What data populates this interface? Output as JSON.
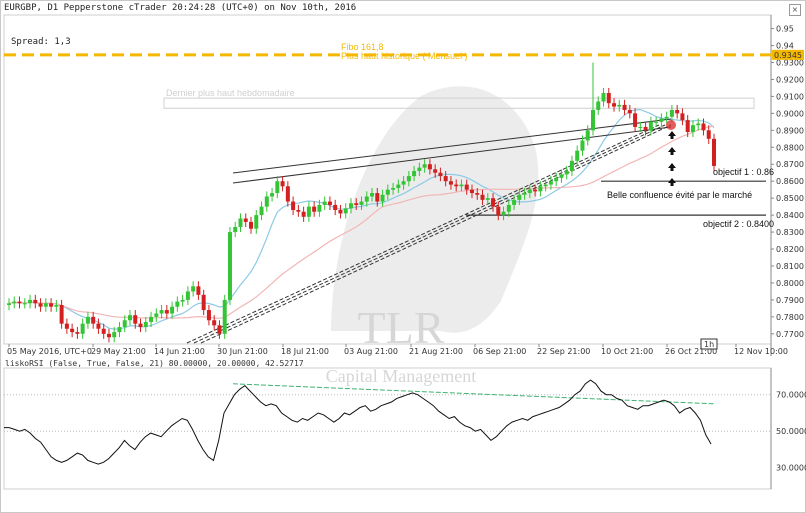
{
  "header": {
    "title": "EURGBP, D1 Pepperstone cTrader 20:24:28 (UTC+0) on Nov 10th, 2016"
  },
  "spread": {
    "label": "Spread:",
    "value": "1,3"
  },
  "colors": {
    "bull": "#35c435",
    "bear": "#d21f1f",
    "fibo": "#f5b800",
    "ma_fast": "#8ecae6",
    "ma_slow": "#f2b6b6",
    "rsi": "#111111",
    "rsi_trend": "#3cb371",
    "price_tag": "#f5b800"
  },
  "annotations": {
    "fibo_line1": "Fibo 161,8",
    "fibo_line2": "Plus haut historique ( Mensuel )",
    "rect_label": "Dernier plus haut hebdomadaire",
    "obj1": "objectif 1 : 0.86",
    "confluence": "Belle confluence évité par le marché",
    "obj2": "objectif 2 : 0.8400",
    "price_tag": "0.9345"
  },
  "timeframe_badge": "1h",
  "indicator": {
    "title": "liskoRSI (False, True, False, 21) 80.00000, 20.00000, 42.52717"
  },
  "watermark": {
    "brand": "TLR",
    "sub": "Capital Management"
  },
  "chart_data": [
    {
      "type": "candlestick",
      "title": "EURGBP, D1",
      "x_tick_labels": [
        "05 May 2016, UTC+0",
        "29 May 21:00",
        "14 Jun 21:00",
        "30 Jun 21:00",
        "18 Jul 21:00",
        "03 Aug 21:00",
        "21 Aug 21:00",
        "06 Sep 21:00",
        "22 Sep 21:00",
        "10 Oct 21:00",
        "26 Oct 21:00",
        "12 Nov 10:00"
      ],
      "y_ticks": [
        0.95,
        0.94,
        0.93,
        0.92,
        0.91,
        0.9,
        0.89,
        0.88,
        0.87,
        0.86,
        0.85,
        0.84,
        0.83,
        0.82,
        0.81,
        0.8,
        0.79,
        0.78,
        0.77
      ],
      "y_tick_labels": [
        "0.95",
        "0.94",
        "0.9300",
        "0.9200",
        "0.9100",
        "0.9000",
        "0.8900",
        "0.8800",
        "0.8700",
        "0.8600",
        "0.8500",
        "0.8400",
        "0.8300",
        "0.8200",
        "0.8100",
        "0.8000",
        "0.7900",
        "0.7800",
        "0.7700"
      ],
      "ylim": [
        0.764,
        0.958
      ],
      "closes": [
        0.788,
        0.789,
        0.788,
        0.788,
        0.79,
        0.788,
        0.786,
        0.788,
        0.786,
        0.787,
        0.776,
        0.773,
        0.771,
        0.77,
        0.776,
        0.78,
        0.776,
        0.773,
        0.77,
        0.768,
        0.771,
        0.774,
        0.778,
        0.781,
        0.776,
        0.774,
        0.777,
        0.78,
        0.782,
        0.784,
        0.782,
        0.786,
        0.789,
        0.79,
        0.795,
        0.798,
        0.793,
        0.784,
        0.778,
        0.775,
        0.77,
        0.79,
        0.83,
        0.833,
        0.838,
        0.836,
        0.832,
        0.84,
        0.845,
        0.851,
        0.853,
        0.86,
        0.857,
        0.848,
        0.843,
        0.842,
        0.839,
        0.845,
        0.842,
        0.846,
        0.848,
        0.846,
        0.843,
        0.841,
        0.844,
        0.847,
        0.846,
        0.848,
        0.851,
        0.853,
        0.848,
        0.852,
        0.855,
        0.856,
        0.858,
        0.86,
        0.863,
        0.866,
        0.868,
        0.87,
        0.867,
        0.865,
        0.863,
        0.86,
        0.858,
        0.857,
        0.858,
        0.855,
        0.853,
        0.852,
        0.849,
        0.85,
        0.845,
        0.84,
        0.842,
        0.846,
        0.849,
        0.852,
        0.853,
        0.855,
        0.854,
        0.857,
        0.858,
        0.86,
        0.862,
        0.864,
        0.866,
        0.872,
        0.878,
        0.884,
        0.89,
        0.902,
        0.907,
        0.912,
        0.906,
        0.904,
        0.905,
        0.902,
        0.9,
        0.892,
        0.892,
        0.89,
        0.895,
        0.895,
        0.897,
        0.898,
        0.902,
        0.9,
        0.896,
        0.889,
        0.893,
        0.894,
        0.89,
        0.885,
        0.869
      ],
      "events": [
        {
          "index": 111,
          "high": 0.93
        },
        {
          "index": 41,
          "high": 0.77
        }
      ],
      "series": [
        {
          "name": "MA fast",
          "values": []
        },
        {
          "name": "MA slow",
          "values": []
        }
      ],
      "levels": [
        {
          "name": "Fibo 161,8",
          "value": 0.9345
        },
        {
          "name": "objectif 1",
          "value": 0.86
        },
        {
          "name": "objectif 2",
          "value": 0.84
        },
        {
          "name": "Dernier plus haut hebdomadaire",
          "value_low": 0.903,
          "value_high": 0.909
        }
      ],
      "grid": true
    },
    {
      "type": "line",
      "title": "liskoRSI (False, True, False, 21)",
      "y_ticks": [
        70,
        50,
        30
      ],
      "y_tick_labels": [
        "70.00000",
        "50.00000",
        "30.00000"
      ],
      "ylim": [
        20,
        83
      ],
      "values": [
        52,
        52,
        51,
        50,
        51,
        49,
        46,
        44,
        40,
        36,
        34,
        33,
        34,
        36,
        38,
        37,
        34,
        33,
        32,
        33,
        35,
        38,
        41,
        45,
        42,
        40,
        44,
        47,
        49,
        48,
        47,
        50,
        53,
        55,
        57,
        56,
        51,
        45,
        40,
        36,
        34,
        45,
        60,
        65,
        70,
        73,
        75,
        72,
        69,
        66,
        64,
        65,
        64,
        60,
        58,
        56,
        55,
        57,
        56,
        58,
        60,
        59,
        57,
        55,
        57,
        60,
        59,
        61,
        63,
        64,
        61,
        62,
        64,
        65,
        66,
        68,
        69,
        70,
        71,
        70,
        68,
        66,
        64,
        61,
        59,
        57,
        58,
        55,
        53,
        52,
        50,
        51,
        48,
        45,
        47,
        50,
        53,
        55,
        56,
        57,
        56,
        58,
        59,
        60,
        61,
        62,
        63,
        65,
        67,
        70,
        72,
        76,
        78,
        76,
        72,
        70,
        70,
        68,
        67,
        64,
        63,
        62,
        64,
        64,
        65,
        66,
        67,
        66,
        64,
        60,
        62,
        63,
        60,
        56,
        48,
        43
      ],
      "levels": [
        70,
        50
      ],
      "grid": true
    }
  ]
}
